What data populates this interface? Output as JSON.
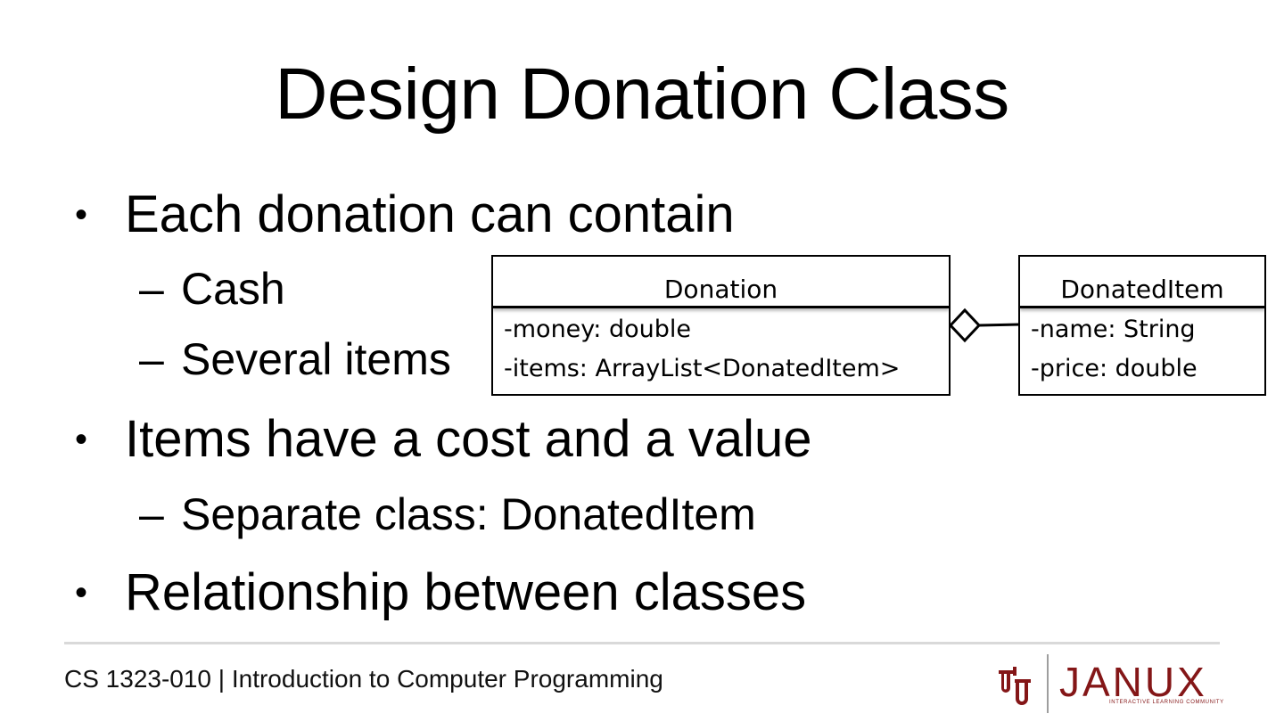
{
  "slide": {
    "title": "Design Donation Class",
    "bullets": [
      {
        "text": "Each donation can contain"
      },
      {
        "text": "Cash"
      },
      {
        "text": "Several items"
      },
      {
        "text": "Items have a cost and a value"
      },
      {
        "text": "Separate class: DonatedItem"
      },
      {
        "text": "Relationship between classes"
      }
    ],
    "bullet_marker": "•",
    "sub_marker": "–"
  },
  "uml": {
    "donation": {
      "name": "Donation",
      "attributes": [
        "-money: double",
        "-items: ArrayList<DonatedItem>"
      ]
    },
    "donated_item": {
      "name": "DonatedItem",
      "attributes": [
        "-name: String",
        "-price: double"
      ]
    },
    "relationship": "aggregation"
  },
  "footer": {
    "course": "CS 1323-010 | Introduction to Computer Programming",
    "logo_text": "JANUX",
    "logo_tagline": "INTERACTIVE LEARNING COMMUNITY",
    "brand_color": "#841617"
  }
}
